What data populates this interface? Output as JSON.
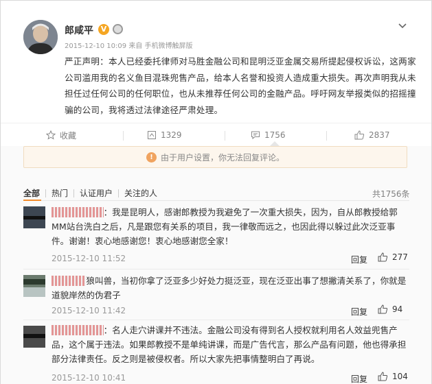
{
  "post": {
    "author": "郎咸平",
    "verified_badge": "V",
    "time": "2015-12-10 10:09",
    "source_prefix": "来自",
    "source": "手机微博触屏版",
    "content": "严正声明：本人已经委托律师对马胜金融公司和昆明泛亚金属交易所提起侵权诉讼，这两家公司滥用我的名义鱼目混珠兜售产品，给本人名誉和投资人造成重大损失。再次声明我从未担任过任何公司的任何职位，也从未推荐任何公司的金融产品。呼吁网友举报类似的招摇撞骗的公司，我将透过法律途径严肃处理。"
  },
  "actions": {
    "favorite_label": "收藏",
    "repost_count": "1329",
    "comment_count": "1756",
    "like_count": "2837"
  },
  "notice": {
    "text": "由于用户设置，你无法回复评论。",
    "icon": "info-icon"
  },
  "filter": {
    "tabs": [
      "全部",
      "热门",
      "认证用户",
      "关注的人"
    ],
    "total": "共1756条"
  },
  "comments": [
    {
      "text": "：我是昆明人，感谢郎教授为我避免了一次重大损失，因为，自从郎教授给郭MM站台洗白之后，凡是跟您有关系的项目，我一律敬而远之，也因此得以躲过此次泛亚事件。谢谢！衷心地感谢您！衷心地感谢您全家！",
      "time": "2015-12-10 11:52",
      "reply": "回复",
      "likes": "277"
    },
    {
      "text": "狼叫兽，当初你拿了泛亚多少好处力挺泛亚，现在泛亚出事了想撇清关系了，你就是道貌岸然的伪君子",
      "time": "2015-12-10 11:42",
      "reply": "回复",
      "likes": "94"
    },
    {
      "text": "：名人走穴讲课并不违法。金融公司没有得到名人授权就利用名人效益兜售产品，这个属于违法。如果郎教授不是单纯讲课，而是广告代言，那么产品有问题，他也得承担部分法律责任。反之则是被侵权者。所以大家先把事情整明白了再说。",
      "time": "2015-12-10 10:41",
      "reply": "回复",
      "likes": "104"
    }
  ],
  "colors": {
    "accent": "#f48b2a",
    "badge": "#f5a623",
    "notice_bg": "#fdf6ed"
  }
}
